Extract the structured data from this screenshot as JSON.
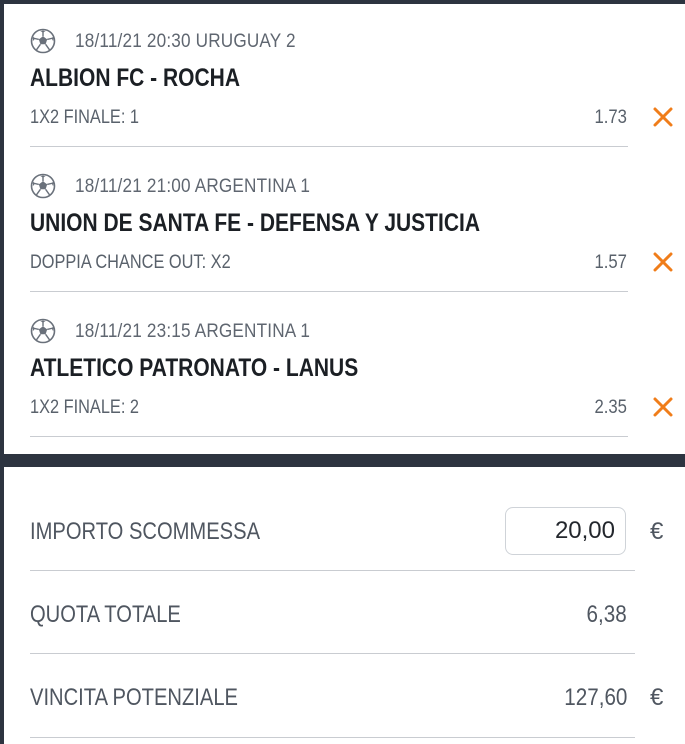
{
  "bets": [
    {
      "datetime": "18/11/21 20:30 URUGUAY 2",
      "match": "ALBION FC - ROCHA",
      "market": "1X2 FINALE: 1",
      "odds": "1.73"
    },
    {
      "datetime": "18/11/21 21:00 ARGENTINA 1",
      "match": "UNION DE SANTA FE - DEFENSA Y JUSTICIA",
      "market": "DOPPIA CHANCE OUT: X2",
      "odds": "1.57"
    },
    {
      "datetime": "18/11/21 23:15 ARGENTINA 1",
      "match": "ATLETICO PATRONATO - LANUS",
      "market": "1X2 FINALE: 2",
      "odds": "2.35"
    }
  ],
  "summary": {
    "stake_label": "IMPORTO SCOMMESSA",
    "stake_value": "20,00",
    "stake_currency": "€",
    "total_odds_label": "QUOTA TOTALE",
    "total_odds_value": "6,38",
    "potential_win_label": "VINCITA POTENZIALE",
    "potential_win_value": "127,60",
    "potential_win_currency": "€"
  },
  "icons": {
    "sport": "soccer-ball-icon",
    "remove": "close-icon"
  },
  "colors": {
    "accent_remove": "#f07d1a",
    "background": "#2d3440"
  }
}
